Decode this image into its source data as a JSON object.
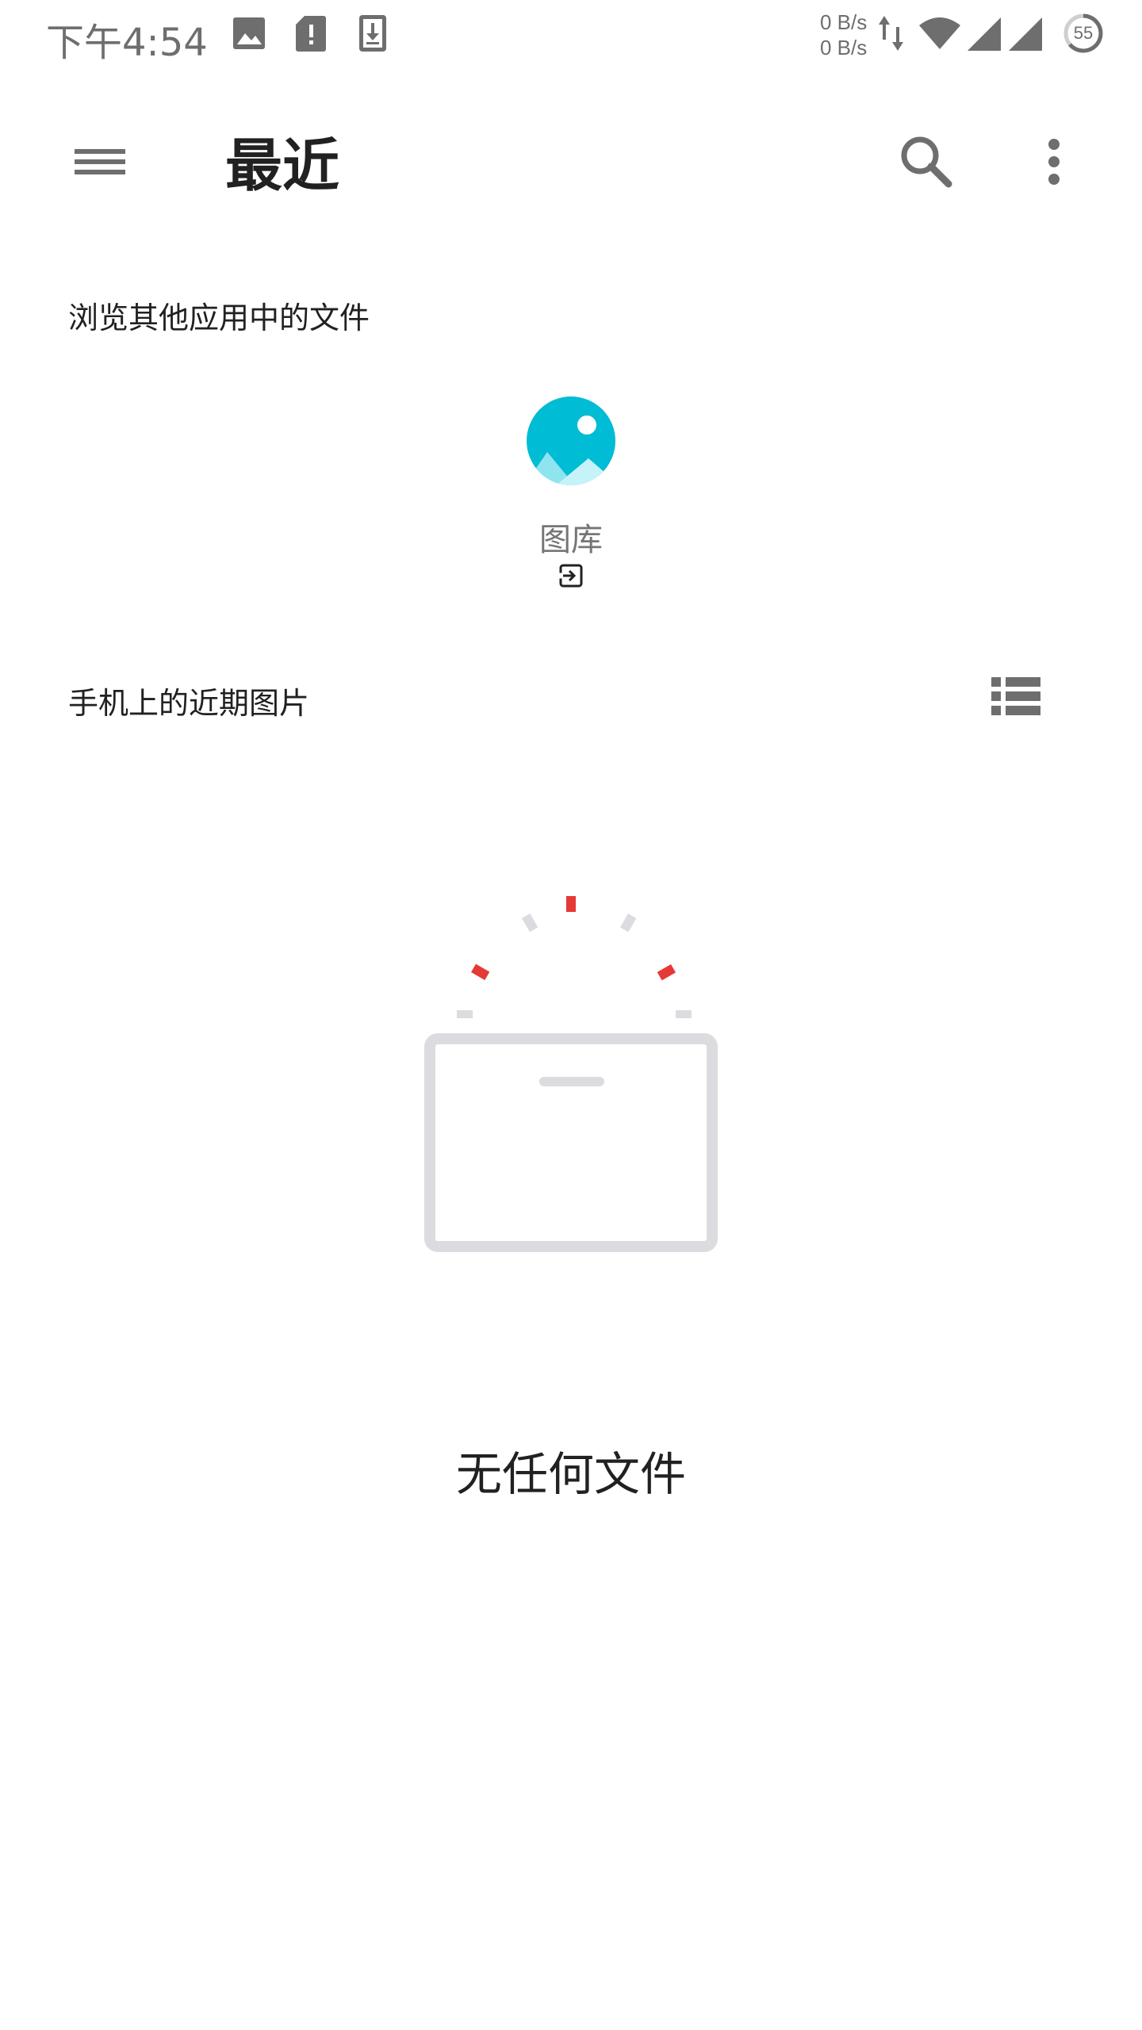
{
  "status_bar": {
    "time": "下午4:54",
    "net_up": "0 B/s",
    "net_down": "0 B/s",
    "battery_level": "55",
    "icons": [
      "image-icon",
      "sd-card-alert-icon",
      "download-icon",
      "data-arrows-icon",
      "wifi-icon",
      "signal-icon",
      "signal-icon-2",
      "battery-icon"
    ]
  },
  "app_bar": {
    "title": "最近",
    "icons": [
      "menu-icon",
      "search-icon",
      "more-vert-icon"
    ]
  },
  "browse_section": {
    "header": "浏览其他应用中的文件",
    "apps": [
      {
        "label": "图库",
        "icon": "gallery-icon",
        "badge_icon": "open-in-app-icon"
      }
    ]
  },
  "recent_section": {
    "header": "手机上的近期图片",
    "view_toggle_icon": "list-view-icon"
  },
  "empty_state": {
    "message": "无任何文件",
    "illustration": "empty-box-illustration"
  },
  "colors": {
    "accent_teal": "#00bcd4",
    "illustration_red": "#e53935",
    "illustration_gray": "#dcdce0",
    "icon_gray": "#6e6e6e",
    "text_primary": "#212121",
    "text_secondary": "#757575"
  }
}
